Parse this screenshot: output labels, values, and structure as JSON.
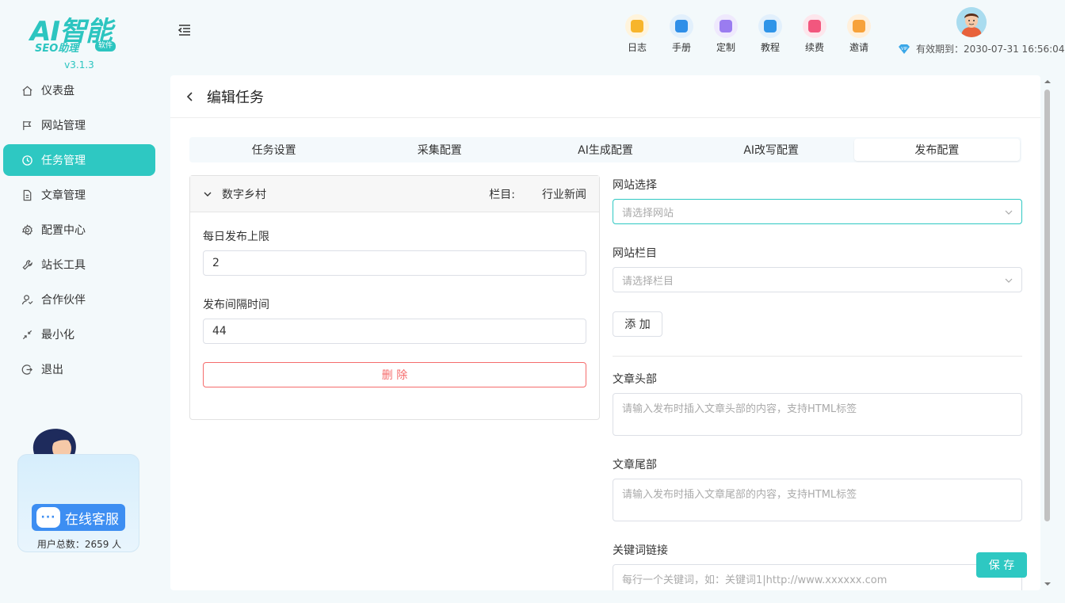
{
  "app": {
    "logo_main": "AI智能",
    "logo_sub": "SEO助理",
    "logo_badge": "软件",
    "version": "v3.1.3"
  },
  "sidebar": {
    "items": [
      {
        "label": "仪表盘",
        "icon": "home-icon",
        "active": false
      },
      {
        "label": "网站管理",
        "icon": "flag-icon",
        "active": false
      },
      {
        "label": "任务管理",
        "icon": "clock-icon",
        "active": true
      },
      {
        "label": "文章管理",
        "icon": "document-icon",
        "active": false
      },
      {
        "label": "配置中心",
        "icon": "gear-icon",
        "active": false
      },
      {
        "label": "站长工具",
        "icon": "wrench-icon",
        "active": false
      },
      {
        "label": "合作伙伴",
        "icon": "user-icon",
        "active": false
      },
      {
        "label": "最小化",
        "icon": "shrink-icon",
        "active": false
      },
      {
        "label": "退出",
        "icon": "logout-icon",
        "active": false
      }
    ],
    "service_label": "在线客服",
    "service_bubble": "···",
    "user_count": "用户总数：2659 人"
  },
  "header": {
    "tools": [
      {
        "label": "日志",
        "icon": "log-icon",
        "color": "#f7b52c",
        "bg": "#fff4dc"
      },
      {
        "label": "手册",
        "icon": "manual-icon",
        "color": "#2f8fe8",
        "bg": "#e2f0fc"
      },
      {
        "label": "定制",
        "icon": "custom-icon",
        "color": "#9a7cf0",
        "bg": "#efe9fd"
      },
      {
        "label": "教程",
        "icon": "tutorial-icon",
        "color": "#2f94e8",
        "bg": "#e2f0fc"
      },
      {
        "label": "续费",
        "icon": "renew-icon",
        "color": "#f2577e",
        "bg": "#fde6ec"
      },
      {
        "label": "邀请",
        "icon": "invite-icon",
        "color": "#f7a23a",
        "bg": "#fff0dc"
      }
    ],
    "expiry_label": "有效期到：2030-07-31 16:56:04"
  },
  "page": {
    "title": "编辑任务",
    "tabs": [
      {
        "label": "任务设置",
        "active": false
      },
      {
        "label": "采集配置",
        "active": false
      },
      {
        "label": "AI生成配置",
        "active": false
      },
      {
        "label": "AI改写配置",
        "active": false
      },
      {
        "label": "发布配置",
        "active": true
      }
    ]
  },
  "site_card": {
    "site_name": "数字乡村",
    "column_label": "栏目:",
    "column_value": "行业新闻",
    "daily_limit_label": "每日发布上限",
    "daily_limit_value": "2",
    "interval_label": "发布间隔时间",
    "interval_value": "44",
    "delete_label": "删 除"
  },
  "form": {
    "site_select_label": "网站选择",
    "site_select_placeholder": "请选择网站",
    "column_select_label": "网站栏目",
    "column_select_placeholder": "请选择栏目",
    "add_label": "添 加",
    "header_label": "文章头部",
    "header_placeholder": "请输入发布时插入文章头部的内容，支持HTML标签",
    "footer_label": "文章尾部",
    "footer_placeholder": "请输入发布时插入文章尾部的内容，支持HTML标签",
    "keyword_label": "关键词链接",
    "keyword_placeholder": "每行一个关键词，如：关键词1|http://www.xxxxxx.com"
  },
  "actions": {
    "save_label": "保 存"
  },
  "colors": {
    "accent": "#2ec8c2",
    "danger": "#f56c6c"
  }
}
